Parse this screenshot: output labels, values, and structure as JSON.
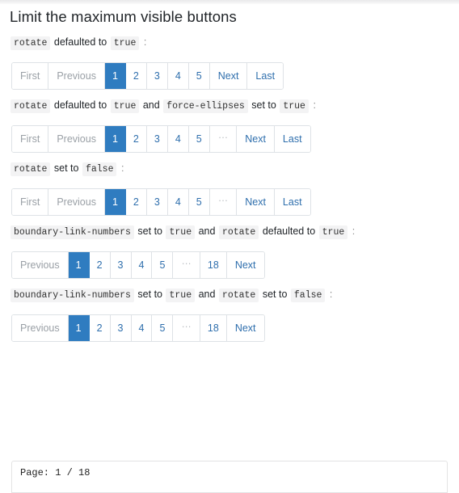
{
  "page": {
    "title": "Limit the maximum visible buttons"
  },
  "sections": [
    {
      "description": {
        "parts": [
          {
            "type": "code",
            "text": "rotate"
          },
          {
            "type": "text",
            "text": "defaulted to"
          },
          {
            "type": "code",
            "text": "true"
          },
          {
            "type": "punct",
            "text": ":"
          }
        ]
      },
      "pagination": {
        "items": [
          {
            "label": "First",
            "state": "disabled",
            "name": "page-first"
          },
          {
            "label": "Previous",
            "state": "disabled",
            "name": "page-previous"
          },
          {
            "label": "1",
            "state": "active",
            "name": "page-1"
          },
          {
            "label": "2",
            "state": "link",
            "name": "page-2"
          },
          {
            "label": "3",
            "state": "link",
            "name": "page-3"
          },
          {
            "label": "4",
            "state": "link",
            "name": "page-4"
          },
          {
            "label": "5",
            "state": "link",
            "name": "page-5"
          },
          {
            "label": "Next",
            "state": "link",
            "name": "page-next"
          },
          {
            "label": "Last",
            "state": "link",
            "name": "page-last"
          }
        ]
      }
    },
    {
      "description": {
        "parts": [
          {
            "type": "code",
            "text": "rotate"
          },
          {
            "type": "text",
            "text": "defaulted to"
          },
          {
            "type": "code",
            "text": "true"
          },
          {
            "type": "text",
            "text": "and"
          },
          {
            "type": "code",
            "text": "force-ellipses"
          },
          {
            "type": "text",
            "text": "set to"
          },
          {
            "type": "code",
            "text": "true"
          },
          {
            "type": "punct",
            "text": ":"
          }
        ]
      },
      "pagination": {
        "items": [
          {
            "label": "First",
            "state": "disabled",
            "name": "page-first"
          },
          {
            "label": "Previous",
            "state": "disabled",
            "name": "page-previous"
          },
          {
            "label": "1",
            "state": "active",
            "name": "page-1"
          },
          {
            "label": "2",
            "state": "link",
            "name": "page-2"
          },
          {
            "label": "3",
            "state": "link",
            "name": "page-3"
          },
          {
            "label": "4",
            "state": "link",
            "name": "page-4"
          },
          {
            "label": "5",
            "state": "link",
            "name": "page-5"
          },
          {
            "label": "…",
            "state": "ellipsis",
            "name": "page-ellipsis"
          },
          {
            "label": "Next",
            "state": "link",
            "name": "page-next"
          },
          {
            "label": "Last",
            "state": "link",
            "name": "page-last"
          }
        ]
      }
    },
    {
      "description": {
        "parts": [
          {
            "type": "code",
            "text": "rotate"
          },
          {
            "type": "text",
            "text": "set to"
          },
          {
            "type": "code",
            "text": "false"
          },
          {
            "type": "punct",
            "text": ":"
          }
        ]
      },
      "pagination": {
        "items": [
          {
            "label": "First",
            "state": "disabled",
            "name": "page-first"
          },
          {
            "label": "Previous",
            "state": "disabled",
            "name": "page-previous"
          },
          {
            "label": "1",
            "state": "active",
            "name": "page-1"
          },
          {
            "label": "2",
            "state": "link",
            "name": "page-2"
          },
          {
            "label": "3",
            "state": "link",
            "name": "page-3"
          },
          {
            "label": "4",
            "state": "link",
            "name": "page-4"
          },
          {
            "label": "5",
            "state": "link",
            "name": "page-5"
          },
          {
            "label": "…",
            "state": "ellipsis",
            "name": "page-ellipsis"
          },
          {
            "label": "Next",
            "state": "link",
            "name": "page-next"
          },
          {
            "label": "Last",
            "state": "link",
            "name": "page-last"
          }
        ]
      }
    },
    {
      "description": {
        "parts": [
          {
            "type": "code",
            "text": "boundary-link-numbers"
          },
          {
            "type": "text",
            "text": "set to"
          },
          {
            "type": "code",
            "text": "true"
          },
          {
            "type": "text",
            "text": "and"
          },
          {
            "type": "code",
            "text": "rotate"
          },
          {
            "type": "text",
            "text": "defaulted to"
          },
          {
            "type": "code",
            "text": "true"
          },
          {
            "type": "punct",
            "text": ":"
          }
        ]
      },
      "pagination": {
        "items": [
          {
            "label": "Previous",
            "state": "disabled",
            "name": "page-previous"
          },
          {
            "label": "1",
            "state": "active",
            "name": "page-1"
          },
          {
            "label": "2",
            "state": "link",
            "name": "page-2"
          },
          {
            "label": "3",
            "state": "link",
            "name": "page-3"
          },
          {
            "label": "4",
            "state": "link",
            "name": "page-4"
          },
          {
            "label": "5",
            "state": "link",
            "name": "page-5"
          },
          {
            "label": "…",
            "state": "ellipsis",
            "name": "page-ellipsis"
          },
          {
            "label": "18",
            "state": "link",
            "name": "page-18"
          },
          {
            "label": "Next",
            "state": "link",
            "name": "page-next"
          }
        ]
      }
    },
    {
      "description": {
        "parts": [
          {
            "type": "code",
            "text": "boundary-link-numbers"
          },
          {
            "type": "text",
            "text": "set to"
          },
          {
            "type": "code",
            "text": "true"
          },
          {
            "type": "text",
            "text": "and"
          },
          {
            "type": "code",
            "text": "rotate"
          },
          {
            "type": "text",
            "text": "set to"
          },
          {
            "type": "code",
            "text": "false"
          },
          {
            "type": "punct",
            "text": ":"
          }
        ]
      },
      "pagination": {
        "items": [
          {
            "label": "Previous",
            "state": "disabled",
            "name": "page-previous"
          },
          {
            "label": "1",
            "state": "active",
            "name": "page-1"
          },
          {
            "label": "2",
            "state": "link",
            "name": "page-2"
          },
          {
            "label": "3",
            "state": "link",
            "name": "page-3"
          },
          {
            "label": "4",
            "state": "link",
            "name": "page-4"
          },
          {
            "label": "5",
            "state": "link",
            "name": "page-5"
          },
          {
            "label": "…",
            "state": "ellipsis",
            "name": "page-ellipsis"
          },
          {
            "label": "18",
            "state": "link",
            "name": "page-18"
          },
          {
            "label": "Next",
            "state": "link",
            "name": "page-next"
          }
        ]
      }
    }
  ],
  "bottom_card": {
    "label": "Page: 1 / 18"
  },
  "colors": {
    "accent": "#2f7cc0",
    "link": "#2f6fad",
    "border": "#dee2e6",
    "code_bg": "#f3f3f4",
    "muted": "#9aa0a6"
  }
}
